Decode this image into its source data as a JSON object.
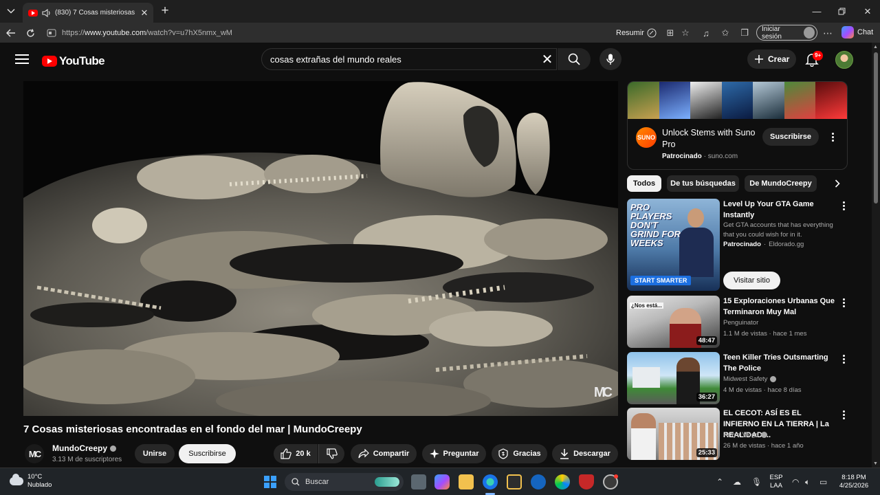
{
  "browser": {
    "tab_title": "(830) 7 Cosas misteriosas encontradas en el fondo del mar | MundoCreepy",
    "url_prefix": "https://",
    "url_host": "www.youtube.com",
    "url_path": "/watch?v=u7hX5nmx_wM",
    "summarize_label": "Resumir",
    "signin_label": "Iniciar sesión",
    "chat_label": "Chat"
  },
  "masthead": {
    "logo_text": "YouTube",
    "search_value": "cosas extrañas del mundo reales",
    "create_label": "Crear",
    "notifications_badge": "9+"
  },
  "video": {
    "title": "7 Cosas misteriosas encontradas en el fondo del mar | MundoCreepy",
    "watermark": "MC",
    "channel": {
      "initials": "MC",
      "name": "MundoCreepy",
      "subscribers": "3.13 M de suscriptores"
    },
    "join_label": "Unirse",
    "subscribe_label": "Suscribirse",
    "likes": "20 k",
    "share_label": "Compartir",
    "ask_label": "Preguntar",
    "thanks_label": "Gracias",
    "download_label": "Descargar"
  },
  "ad": {
    "logo_text": "SUNO",
    "title": "Unlock Stems with Suno Pro",
    "sponsored": "Patrocinado",
    "domain": "suno.com",
    "subscribe_label": "Suscribirse"
  },
  "chips": [
    "Todos",
    "De tus búsquedas",
    "De MundoCreepy"
  ],
  "sponsored_rec": {
    "thumb_lines": [
      "PRO",
      "PLAYERS",
      "DON'T",
      "GRIND FOR",
      "WEEKS"
    ],
    "thumb_button": "START SMARTER",
    "title": "Level Up Your GTA Game Instantly",
    "description": "Get GTA accounts that has everything that you could wish for in it.",
    "sponsored": "Patrocinado",
    "domain": "Eldorado.gg",
    "visit_label": "Visitar sitio"
  },
  "recommendations": [
    {
      "title": "15 Exploraciones Urbanas Que Terminaron Muy Mal",
      "channel": "Penguinator",
      "verified": false,
      "meta": "1.1 M de vistas · hace 1 mes",
      "duration": "48:47",
      "thumb_caption": "¿Nos está..."
    },
    {
      "title": "Teen Killer Tries Outsmarting The Police",
      "channel": "Midwest Safety",
      "verified": true,
      "meta": "4 M de vistas · hace 8 días",
      "duration": "36:27"
    },
    {
      "title": "EL CECOT: ASÍ ES EL INFIERNO EN LA TIERRA | La REALIDAD ...",
      "channel": "Araya Vlogs",
      "verified": true,
      "meta": "26 M de vistas · hace 1 año",
      "duration": "25:33"
    }
  ],
  "taskbar": {
    "temperature": "10°C",
    "weather": "Nublado",
    "search_label": "Buscar",
    "lang_top": "ESP",
    "lang_bottom": "LAA",
    "time": "8:18 PM",
    "date": "4/25/2026"
  },
  "colors": {
    "brand_red": "#ff0000",
    "background": "#0f0f0f",
    "chip_active": "#f1f1f1"
  }
}
